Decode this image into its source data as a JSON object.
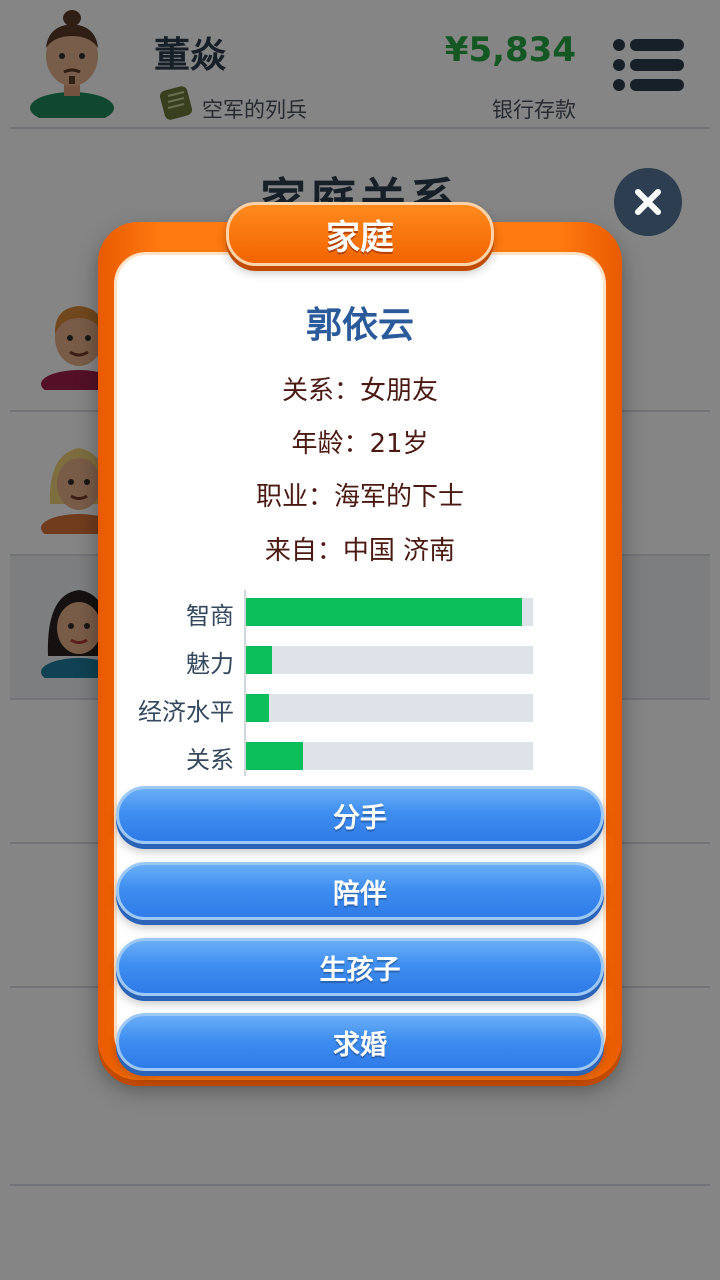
{
  "header": {
    "player_name": "董焱",
    "rank": "空军的列兵",
    "money": "¥5,834",
    "money_label": "银行存款"
  },
  "page_title": "家庭关系",
  "modal": {
    "tab_title": "家庭",
    "name": "郭依云",
    "relation_line": "关系：女朋友",
    "age_line": "年龄：21岁",
    "job_line": "职业：海军的下士",
    "from_line": "来自：中国 济南",
    "stats": [
      {
        "label": "智商",
        "value": 0.96
      },
      {
        "label": "魅力",
        "value": 0.09
      },
      {
        "label": "经济水平",
        "value": 0.08
      },
      {
        "label": "关系",
        "value": 0.2
      }
    ],
    "buttons": [
      "分手",
      "陪伴",
      "生孩子",
      "求婚"
    ]
  },
  "colors": {
    "accent_orange": "#ff7a10",
    "button_blue": "#3f8ef0",
    "stat_green": "#0dbf5b",
    "money_green": "#27a844",
    "name_blue": "#2a5a9a"
  },
  "icons": [
    "player-avatar-icon",
    "rank-insignia-icon",
    "hamburger-menu-icon",
    "close-icon",
    "family-avatar-icon"
  ]
}
